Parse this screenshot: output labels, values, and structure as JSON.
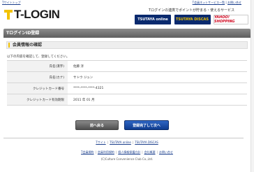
{
  "top": {
    "left_link": "Tサイトトップ",
    "right_links": [
      "T会員ネットサービス一覧",
      "お問い合せ"
    ]
  },
  "logo": {
    "text": "T-LOGIN"
  },
  "promo": {
    "text": "Tログインの連携でポイントが貯まる・使えるサービス",
    "badges": [
      "TSUTAYA online",
      "TSUTAYA DISCAS",
      "YAHOO! SHOPPING"
    ]
  },
  "page": {
    "title": "TログインID登録",
    "section_title": "会員情報の確認",
    "note": "以下の内容を確認して、登録してください。"
  },
  "form": {
    "rows": [
      {
        "label": "氏名(漢字)",
        "value": "佐藤 淳"
      },
      {
        "label": "氏名(カナ)",
        "value": "サトウ ジュン"
      },
      {
        "label": "クレジットカード番号",
        "value": "****-****-****-4321"
      },
      {
        "label": "クレジットカード有効期限",
        "value": "2011 年 01 月"
      }
    ]
  },
  "buttons": {
    "back": "前へ戻る",
    "next": "登録完了して次へ"
  },
  "footer": {
    "links1": [
      "Tサイト",
      "TSUTAYA online",
      "TSUTAYA DISCAS"
    ],
    "links2": [
      "T会員規約",
      "会員利用規約",
      "個人情報保護方針",
      "会社概要",
      "お問い合せ"
    ],
    "copyright": "(C)Culture Convenience Club Co.,Ltd."
  }
}
